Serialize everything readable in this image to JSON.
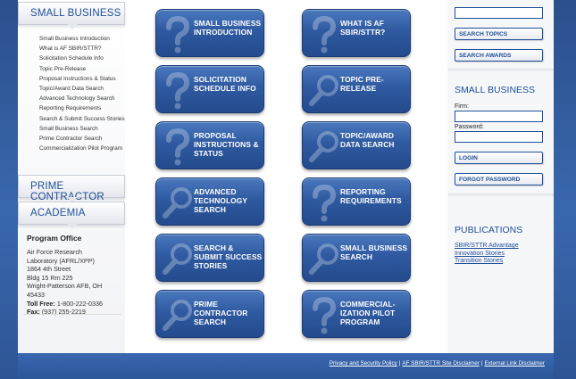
{
  "left_sidebar": {
    "small_business_heading": "SMALL BUSINESS",
    "nav_items": [
      "Small Business Introduction",
      "What is AF SBIR/STTR?",
      "Solicitation Schedule Info",
      "Topic Pre-Release",
      "Proposal Instructions & Status",
      "Topic/Award Data Search",
      "Advanced Technology Search",
      "Reporting Requirements",
      "Search & Submit Success Stories",
      "Small Business Search",
      "Prime Contractor Search",
      "Commercialization Pilot Program"
    ],
    "prime_contractor_heading": "PRIME CONTRACTOR",
    "academia_heading": "ACADEMIA",
    "program_office": {
      "title": "Program Office",
      "lines": [
        "Air Force Research",
        "Laboratory (AFRL/XPP)",
        "1864 4th Street",
        "Bldg 15 Rm 225",
        "Wright-Patterson AFB, OH",
        "45433"
      ],
      "toll_free_label": "Toll Free:",
      "toll_free": "1-800-222-0336",
      "fax_label": "Fax:",
      "fax": "(937) 255-2219"
    }
  },
  "tiles": [
    {
      "label": "Small Business Introduction",
      "icon": "question-icon"
    },
    {
      "label": "What is AF SBIR/STTR?",
      "icon": "question-icon"
    },
    {
      "label": "Solicitation Schedule Info",
      "icon": "question-icon"
    },
    {
      "label": "Topic Pre-Release",
      "icon": "magnifier-icon"
    },
    {
      "label": "Proposal Instructions & Status",
      "icon": "question-icon"
    },
    {
      "label": "Topic/Award Data Search",
      "icon": "magnifier-icon"
    },
    {
      "label": "Advanced Technology Search",
      "icon": "magnifier-icon"
    },
    {
      "label": "Reporting Requirements",
      "icon": "question-icon"
    },
    {
      "label": "Search & Submit Success Stories",
      "icon": "magnifier-icon"
    },
    {
      "label": "Small Business Search",
      "icon": "magnifier-icon"
    },
    {
      "label": "Prime Contractor Search",
      "icon": "magnifier-icon"
    },
    {
      "label": "Commercial-ization Pilot Program",
      "icon": "question-icon"
    }
  ],
  "right_sidebar": {
    "search_value": "",
    "search_topics_button": "SEARCH TOPICS",
    "search_awards_button": "SEARCH AWARDS",
    "login_heading": "SMALL BUSINESS",
    "firm_label": "Firm:",
    "firm_value": "",
    "password_label": "Password:",
    "password_value": "",
    "login_button": "LOGIN",
    "forgot_button": "FORGOT PASSWORD",
    "publications_heading": "PUBLICATIONS",
    "publication_links": [
      "SBIR/STTR Advantage",
      "Innovation Stories",
      "Transition Stories"
    ]
  },
  "footer": {
    "links": [
      "Privacy and Security Policy",
      "AF SBIR/STTR Site Disclaimer",
      "External Link Disclaimer"
    ],
    "separator": "|"
  },
  "colors": {
    "brand_blue": "#1f4f99",
    "tile_blue": "#2f5aa1",
    "background_blue": "#3a68ad"
  }
}
